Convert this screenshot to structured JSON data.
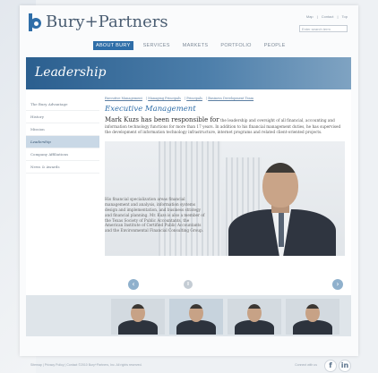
{
  "brand": {
    "name": "Bury+Partners"
  },
  "util": {
    "links": [
      "Map",
      "Contact",
      "Top"
    ],
    "search_placeholder": "Enter search term"
  },
  "nav": {
    "items": [
      "ABOUT BURY",
      "SERVICES",
      "MARKETS",
      "PORTFOLIO",
      "PEOPLE"
    ],
    "active": 0
  },
  "banner": {
    "title": "Leadership"
  },
  "sidebar": {
    "items": [
      "The Bury Advantage",
      "History",
      "Mission",
      "Leadership",
      "Company Affiliations",
      "News & Awards"
    ],
    "selected": 3
  },
  "breadcrumb": [
    "Executive Management",
    "Managing Principals",
    "Principals",
    "Business Development Team"
  ],
  "main": {
    "heading": "Executive Management",
    "lead_name": "Mark Kuzs has been responsible for",
    "lead_rest": "the leadership and oversight of all financial, accounting and information technology functions for more than 17 years. In addition to his financial management duties, he has supervised the development of information technology infrastructure, internet programs and related client-oriented projects.",
    "body": "His financial specialization areas financial management and analysis, information systems design and implementation, and business strategy and financial planning. Mr. Kuzs is also a member of the Texas Society of Public Accountants, the American Institute of Certified Public Accountants and the Environmental Financial Consulting Group."
  },
  "carousel": {
    "prev": "‹",
    "next": "›",
    "pause": "II",
    "thumbs": 4,
    "selected": 1
  },
  "footer": {
    "left": "Sitemap  |  Privacy Policy  |  Contact   ©2010 Bury+Partners, Inc. All rights reserved.",
    "right": "Connect with us",
    "social": [
      "f",
      "in"
    ]
  },
  "colors": {
    "accent": "#2f6ea8",
    "banner": "#2b5f8f"
  }
}
